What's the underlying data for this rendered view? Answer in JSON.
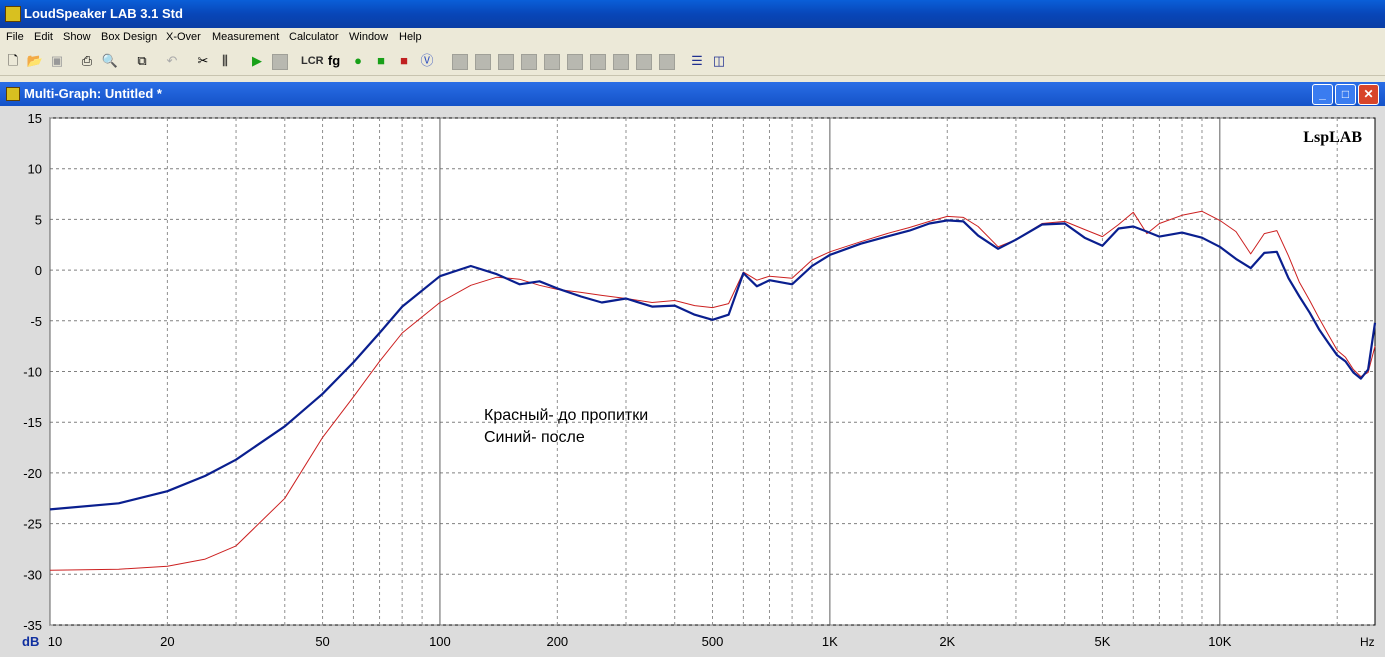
{
  "app": {
    "title": "LoudSpeaker LAB 3.1 Std"
  },
  "menu": [
    "File",
    "Edit",
    "Show",
    "Box Design",
    "X-Over",
    "Measurement",
    "Calculator",
    "Window",
    "Help"
  ],
  "window": {
    "title": "Multi-Graph: Untitled *"
  },
  "plot": {
    "logo": "LspLAB",
    "annotation_line1": "Красный- до пропитки",
    "annotation_line2": "Синий- после",
    "y_unit": "dB",
    "x_unit": "Hz"
  },
  "chart_data": {
    "type": "line",
    "xscale": "log",
    "xlim": [
      10,
      25000
    ],
    "ylim": [
      -35,
      15
    ],
    "grid": true,
    "yticks": [
      15,
      10,
      5,
      0,
      -5,
      -10,
      -15,
      -20,
      -25,
      -30,
      -35
    ],
    "xticks": [
      {
        "value": 10,
        "label": "10"
      },
      {
        "value": 20,
        "label": "20"
      },
      {
        "value": 50,
        "label": "50"
      },
      {
        "value": 100,
        "label": "100"
      },
      {
        "value": 200,
        "label": "200"
      },
      {
        "value": 500,
        "label": "500"
      },
      {
        "value": 1000,
        "label": "1K"
      },
      {
        "value": 2000,
        "label": "2K"
      },
      {
        "value": 5000,
        "label": "5K"
      },
      {
        "value": 10000,
        "label": "10K"
      }
    ],
    "series": [
      {
        "color": "#cc2020",
        "x": [
          10,
          15,
          20,
          25,
          30,
          40,
          50,
          60,
          70,
          80,
          100,
          120,
          140,
          160,
          180,
          200,
          230,
          260,
          300,
          350,
          400,
          450,
          500,
          550,
          600,
          650,
          700,
          800,
          900,
          1000,
          1200,
          1400,
          1600,
          1800,
          2000,
          2200,
          2400,
          2700,
          3000,
          3500,
          4000,
          4500,
          5000,
          5500,
          6000,
          6500,
          7000,
          8000,
          9000,
          10000,
          11000,
          12000,
          13000,
          14000,
          15000,
          16000,
          17000,
          18000,
          19000,
          20000,
          21000,
          22000,
          23000,
          24000,
          25000
        ],
        "y": [
          -29.6,
          -29.5,
          -29.2,
          -28.5,
          -27.2,
          -22.5,
          -16.5,
          -12.5,
          -9,
          -6.2,
          -3.2,
          -1.5,
          -0.7,
          -0.9,
          -1.5,
          -1.9,
          -2.2,
          -2.5,
          -2.8,
          -3.2,
          -3,
          -3.5,
          -3.7,
          -3.3,
          -0.2,
          -1,
          -0.6,
          -0.8,
          1,
          1.8,
          2.8,
          3.6,
          4.2,
          4.8,
          5.3,
          5.2,
          4.3,
          2.3,
          3,
          4.6,
          4.8,
          4,
          3.3,
          4.5,
          5.7,
          3.6,
          4.6,
          5.4,
          5.8,
          4.9,
          3.8,
          1.6,
          3.6,
          3.9,
          1.4,
          -1.2,
          -3,
          -4.8,
          -6.4,
          -7.9,
          -8.6,
          -9.8,
          -10.5,
          -10.1,
          -7.5
        ]
      },
      {
        "color": "#0a1f8f",
        "x": [
          10,
          15,
          20,
          25,
          30,
          40,
          50,
          60,
          70,
          80,
          100,
          120,
          140,
          160,
          180,
          200,
          230,
          260,
          300,
          350,
          400,
          450,
          500,
          550,
          600,
          650,
          700,
          800,
          900,
          1000,
          1200,
          1400,
          1600,
          1800,
          2000,
          2200,
          2400,
          2700,
          3000,
          3500,
          4000,
          4500,
          5000,
          5500,
          6000,
          6500,
          7000,
          8000,
          9000,
          10000,
          11000,
          12000,
          13000,
          14000,
          15000,
          16000,
          17000,
          18000,
          19000,
          20000,
          21000,
          22000,
          23000,
          24000,
          25000
        ],
        "y": [
          -23.6,
          -23,
          -21.8,
          -20.3,
          -18.7,
          -15.4,
          -12.2,
          -9.1,
          -6.2,
          -3.6,
          -0.6,
          0.4,
          -0.4,
          -1.4,
          -1.1,
          -1.8,
          -2.6,
          -3.2,
          -2.8,
          -3.6,
          -3.5,
          -4.4,
          -4.9,
          -4.4,
          -0.3,
          -1.6,
          -1,
          -1.4,
          0.4,
          1.5,
          2.6,
          3.3,
          3.9,
          4.6,
          4.9,
          4.8,
          3.4,
          2.1,
          3,
          4.5,
          4.6,
          3.2,
          2.4,
          4.1,
          4.3,
          3.8,
          3.3,
          3.7,
          3.2,
          2.3,
          1.1,
          0.2,
          1.7,
          1.8,
          -0.8,
          -2.6,
          -4.2,
          -5.9,
          -7.2,
          -8.4,
          -9,
          -10.1,
          -10.7,
          -9.8,
          -5.2
        ]
      }
    ]
  },
  "colors": {
    "plot_bg": "#ffffff",
    "frame_bg": "#dcdcdc",
    "grid": "#808080",
    "titlebar": "#0846b8"
  },
  "icons": [
    "new-icon",
    "open-icon",
    "save-icon",
    "print-icon",
    "print-preview-icon",
    "copy-icon",
    "undo-icon",
    "tools-icon",
    "sliders-icon",
    "play-icon",
    "stop-icon",
    "lcr-icon",
    "fg-icon",
    "circle-icon",
    "green-square-icon",
    "red-graph-icon",
    "v-icon",
    "tile-horizontal-icon",
    "tile-vertical-icon"
  ]
}
